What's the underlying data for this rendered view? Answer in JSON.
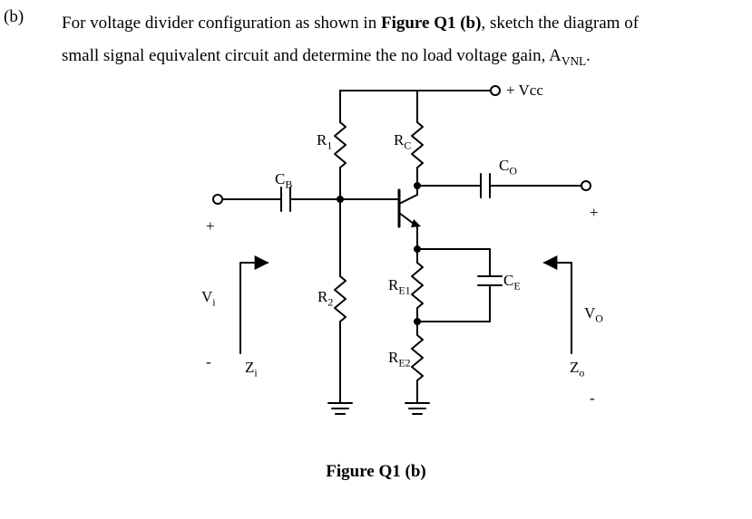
{
  "part_label": "(b)",
  "question": {
    "line1_pre": "For voltage divider configuration as shown in ",
    "figure_ref": "Figure Q1 (b)",
    "line1_post": ", sketch the diagram of",
    "line2_pre": "small signal equivalent circuit and determine the no load voltage gain, A",
    "gain_sub": "VNL",
    "line2_post": "."
  },
  "labels": {
    "vcc": "+ Vcc",
    "r1": "R",
    "r1_sub": "1",
    "rc": "R",
    "rc_sub": "C",
    "co": "C",
    "co_sub": "O",
    "cb": "C",
    "cb_sub": "B",
    "re1": "R",
    "re1_sub": "E1",
    "ce": "C",
    "ce_sub": "E",
    "vi": "V",
    "vi_sub": "i",
    "r2": "R",
    "r2_sub": "2",
    "vo": "V",
    "vo_sub": "O",
    "re2": "R",
    "re2_sub": "E2",
    "zi": "Z",
    "zi_sub": "i",
    "zo": "Z",
    "zo_sub": "o",
    "plus": "+",
    "minus": "-"
  },
  "caption": "Figure Q1 (b)"
}
